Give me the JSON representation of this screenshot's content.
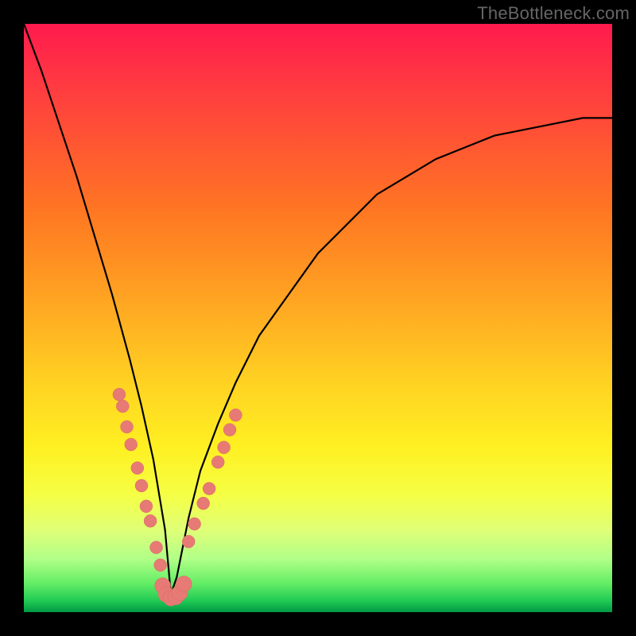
{
  "watermark": "TheBottleneck.com",
  "colors": {
    "frame": "#000000",
    "curve": "#000000",
    "marker": "#e77a74",
    "gradient_top": "#ff1a4d",
    "gradient_bottom": "#009944"
  },
  "chart_data": {
    "type": "line",
    "title": "",
    "xlabel": "",
    "ylabel": "",
    "xlim": [
      0,
      100
    ],
    "ylim": [
      0,
      100
    ],
    "grid": false,
    "legend": false,
    "description": "V-shaped bottleneck curve with steep left branch and shallower right branch; minimum (y≈0) near x≈25. Salmon-colored data points cluster on both branches in the lower third and along the valley floor.",
    "series": [
      {
        "name": "bottleneck-curve",
        "x": [
          0,
          3,
          6,
          9,
          12,
          15,
          18,
          20,
          22,
          24,
          25,
          26,
          28,
          30,
          33,
          36,
          40,
          45,
          50,
          55,
          60,
          65,
          70,
          75,
          80,
          85,
          90,
          95,
          100
        ],
        "y": [
          100,
          92,
          83,
          74,
          64,
          54,
          43,
          35,
          26,
          14,
          3,
          6,
          16,
          24,
          32,
          39,
          47,
          54,
          61,
          66,
          71,
          74,
          77,
          79,
          81,
          82,
          83,
          84,
          84
        ]
      }
    ],
    "markers": {
      "left_branch": [
        {
          "x": 16.2,
          "y": 37.0
        },
        {
          "x": 16.8,
          "y": 35.0
        },
        {
          "x": 17.5,
          "y": 31.5
        },
        {
          "x": 18.2,
          "y": 28.5
        },
        {
          "x": 19.3,
          "y": 24.5
        },
        {
          "x": 20.0,
          "y": 21.5
        },
        {
          "x": 20.8,
          "y": 18.0
        },
        {
          "x": 21.5,
          "y": 15.5
        },
        {
          "x": 22.5,
          "y": 11.0
        },
        {
          "x": 23.2,
          "y": 8.0
        }
      ],
      "right_branch": [
        {
          "x": 28.0,
          "y": 12.0
        },
        {
          "x": 29.0,
          "y": 15.0
        },
        {
          "x": 30.5,
          "y": 18.5
        },
        {
          "x": 31.5,
          "y": 21.0
        },
        {
          "x": 33.0,
          "y": 25.5
        },
        {
          "x": 34.0,
          "y": 28.0
        },
        {
          "x": 35.0,
          "y": 31.0
        },
        {
          "x": 36.0,
          "y": 33.5
        }
      ],
      "valley_blob": [
        {
          "x": 23.6,
          "y": 4.5
        },
        {
          "x": 24.2,
          "y": 3.0
        },
        {
          "x": 25.0,
          "y": 2.4
        },
        {
          "x": 25.8,
          "y": 2.6
        },
        {
          "x": 26.5,
          "y": 3.3
        },
        {
          "x": 27.2,
          "y": 4.8
        }
      ]
    }
  }
}
